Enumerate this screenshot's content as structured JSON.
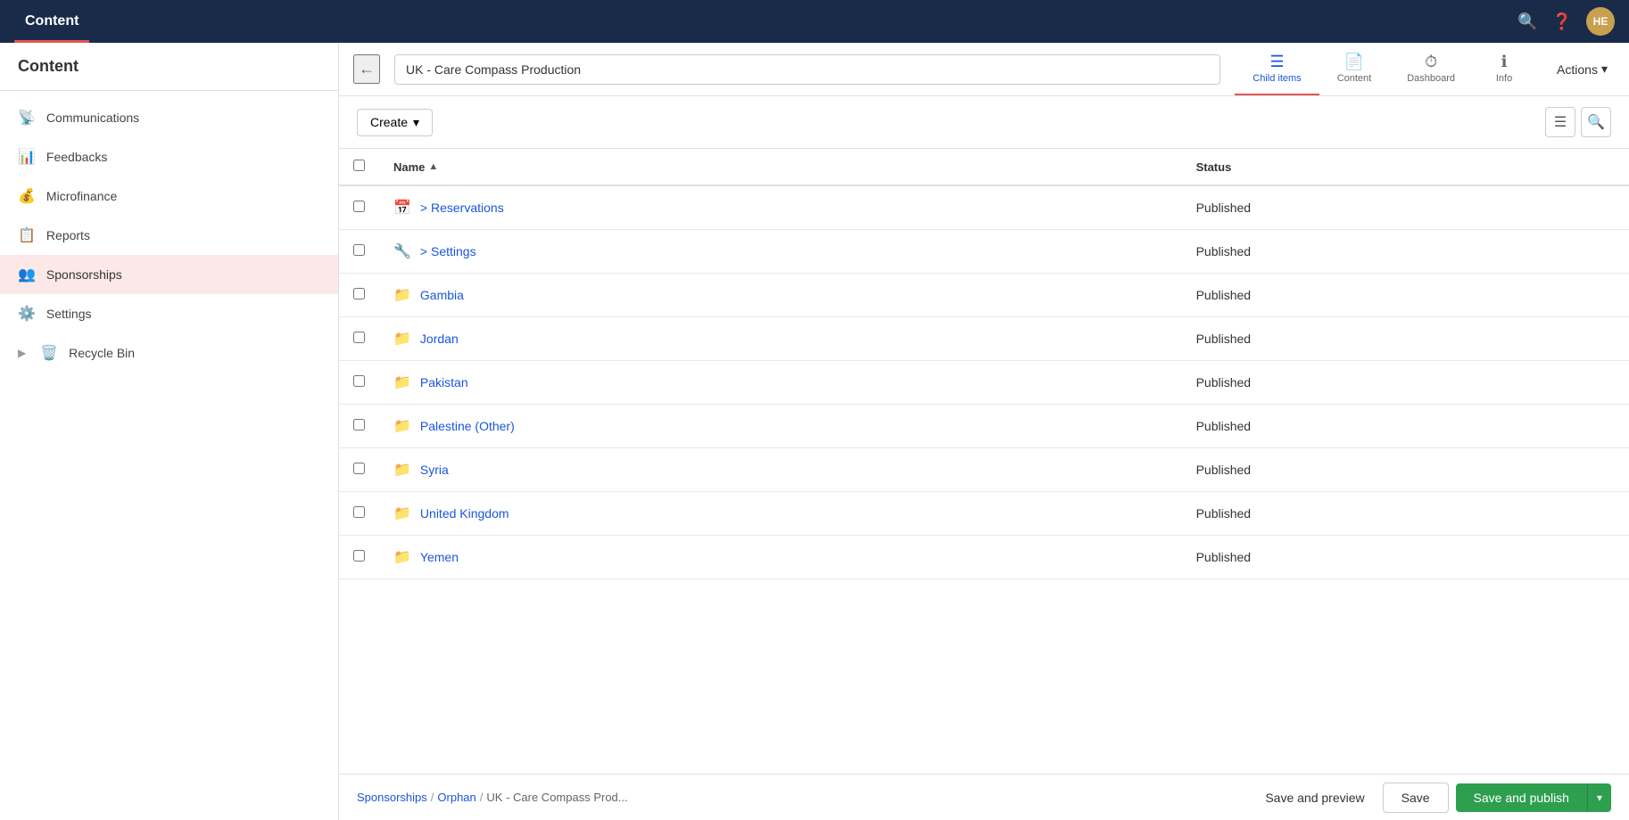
{
  "topNav": {
    "title": "Content",
    "activeTab": "Content",
    "userInitials": "HE",
    "searchIcon": "🔍",
    "helpIcon": "❓"
  },
  "sidebar": {
    "header": "Content",
    "items": [
      {
        "id": "communications",
        "label": "Communications",
        "icon": "📡"
      },
      {
        "id": "feedbacks",
        "label": "Feedbacks",
        "icon": "📊"
      },
      {
        "id": "microfinance",
        "label": "Microfinance",
        "icon": "💰"
      },
      {
        "id": "reports",
        "label": "Reports",
        "icon": "📋"
      },
      {
        "id": "sponsorships",
        "label": "Sponsorships",
        "icon": "👥",
        "active": true
      },
      {
        "id": "settings",
        "label": "Settings",
        "icon": "⚙️"
      },
      {
        "id": "recycle-bin",
        "label": "Recycle Bin",
        "icon": "🗑️",
        "hasExpand": true
      }
    ]
  },
  "contentHeader": {
    "pageTitle": "UK - Care Compass Production",
    "backIcon": "←",
    "tabs": [
      {
        "id": "child-items",
        "label": "Child items",
        "icon": "≡",
        "active": true
      },
      {
        "id": "content",
        "label": "Content",
        "icon": "📄",
        "active": false
      },
      {
        "id": "dashboard",
        "label": "Dashboard",
        "icon": "🎯",
        "active": false
      },
      {
        "id": "info",
        "label": "Info",
        "icon": "ℹ",
        "active": false
      }
    ],
    "actionsLabel": "Actions",
    "actionsIcon": "▾"
  },
  "toolbar": {
    "createLabel": "Create",
    "createDropIcon": "▾",
    "listViewIcon": "≡",
    "searchIcon": "🔍"
  },
  "table": {
    "columns": [
      {
        "id": "name",
        "label": "Name",
        "sortIcon": "▲"
      },
      {
        "id": "status",
        "label": "Status"
      }
    ],
    "rows": [
      {
        "id": 1,
        "icon": "📅",
        "name": "> Reservations",
        "status": "Published"
      },
      {
        "id": 2,
        "icon": "🔧",
        "name": "> Settings",
        "status": "Published"
      },
      {
        "id": 3,
        "icon": "📁",
        "name": "Gambia",
        "status": "Published"
      },
      {
        "id": 4,
        "icon": "📁",
        "name": "Jordan",
        "status": "Published"
      },
      {
        "id": 5,
        "icon": "📁",
        "name": "Pakistan",
        "status": "Published"
      },
      {
        "id": 6,
        "icon": "📁",
        "name": "Palestine (Other)",
        "status": "Published"
      },
      {
        "id": 7,
        "icon": "📁",
        "name": "Syria",
        "status": "Published"
      },
      {
        "id": 8,
        "icon": "📁",
        "name": "United Kingdom",
        "status": "Published"
      },
      {
        "id": 9,
        "icon": "📁",
        "name": "Yemen",
        "status": "Published"
      }
    ]
  },
  "bottomBar": {
    "breadcrumb": [
      {
        "id": "sponsorships",
        "label": "Sponsorships",
        "link": true
      },
      {
        "id": "orphan",
        "label": "Orphan",
        "link": true
      },
      {
        "id": "current",
        "label": "UK - Care Compass Prod...",
        "link": false
      }
    ],
    "saveAndPreviewLabel": "Save and preview",
    "saveLabel": "Save",
    "saveAndPublishLabel": "Save and publish",
    "saveAndPublishDropdownIcon": "▾"
  }
}
